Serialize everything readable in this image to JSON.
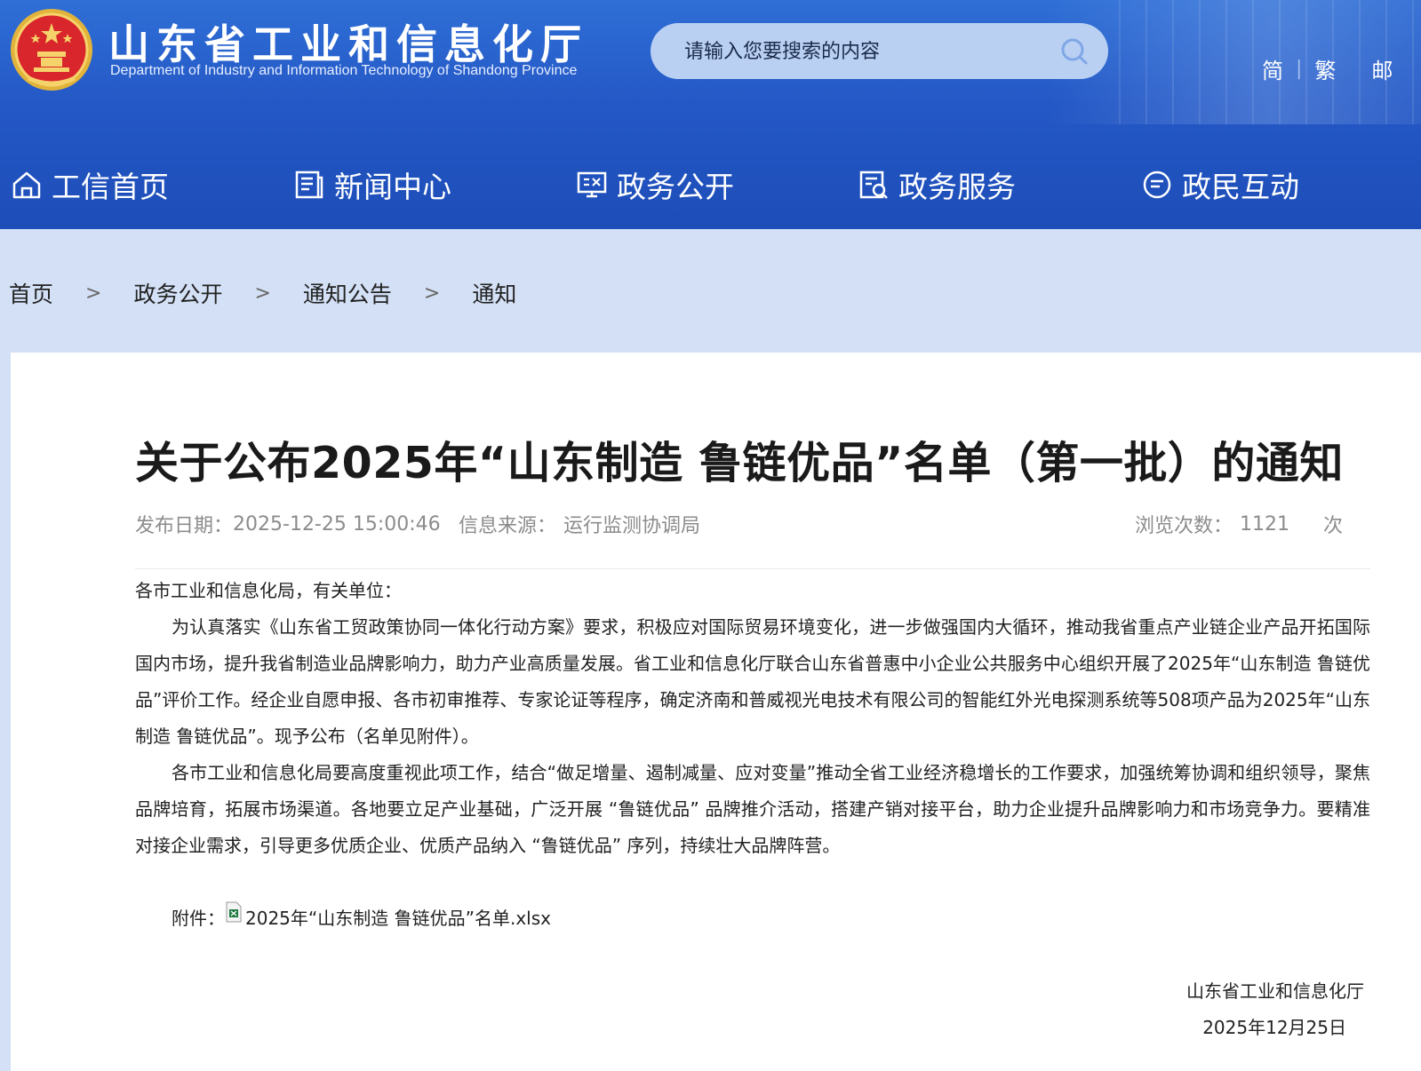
{
  "header": {
    "site_title": "山东省工业和信息化厅",
    "site_subtitle": "Department of Industry and Information Technology of Shandong Province",
    "search_placeholder": "请输入您要搜索的内容",
    "lang_simplified": "简",
    "lang_separator": "|",
    "lang_traditional": "繁",
    "lang_partial": "邮",
    "brand_color": "#2458c6"
  },
  "nav": {
    "items": [
      {
        "label": "工信首页",
        "icon": "home-icon"
      },
      {
        "label": "新闻中心",
        "icon": "news-icon"
      },
      {
        "label": "政务公开",
        "icon": "monitor-icon"
      },
      {
        "label": "政务服务",
        "icon": "service-icon"
      },
      {
        "label": "政民互动",
        "icon": "chat-icon"
      }
    ]
  },
  "breadcrumb": {
    "items": [
      "首页",
      "政务公开",
      "通知公告",
      "通知"
    ],
    "separator": ">"
  },
  "article": {
    "title": "关于公布2025年“山东制造 鲁链优品”名单（第一批）的通知",
    "publish_label": "发布日期：",
    "publish_date": "2025-12-25 15:00:46",
    "source_label": "信息来源：",
    "source": "运行监测协调局",
    "views_label": "浏览次数：",
    "views": "1121",
    "views_unit": "次",
    "salutation": "各市工业和信息化局，有关单位：",
    "paragraphs": [
      "为认真落实《山东省工贸政策协同一体化行动方案》要求，积极应对国际贸易环境变化，进一步做强国内大循环，推动我省重点产业链企业产品开拓国际国内市场，提升我省制造业品牌影响力，助力产业高质量发展。省工业和信息化厅联合山东省普惠中小企业公共服务中心组织开展了2025年“山东制造 鲁链优品”评价工作。经企业自愿申报、各市初审推荐、专家论证等程序，确定济南和普威视光电技术有限公司的智能红外光电探测系统等508项产品为2025年“山东制造 鲁链优品”。现予公布（名单见附件）。",
      "各市工业和信息化局要高度重视此项工作，结合“做足增量、遏制减量、应对变量”推动全省工业经济稳增长的工作要求，加强统筹协调和组织领导，聚焦品牌培育，拓展市场渠道。各地要立足产业基础，广泛开展 “鲁链优品” 品牌推介活动，搭建产销对接平台，助力企业提升品牌影响力和市场竞争力。要精准对接企业需求，引导更多优质企业、优质产品纳入 “鲁链优品” 序列，持续壮大品牌阵营。"
    ],
    "attachment_label": "附件：",
    "attachment_file": "2025年“山东制造 鲁链优品”名单.xlsx",
    "signature_org": "山东省工业和信息化厅",
    "signature_date": "2025年12月25日"
  }
}
